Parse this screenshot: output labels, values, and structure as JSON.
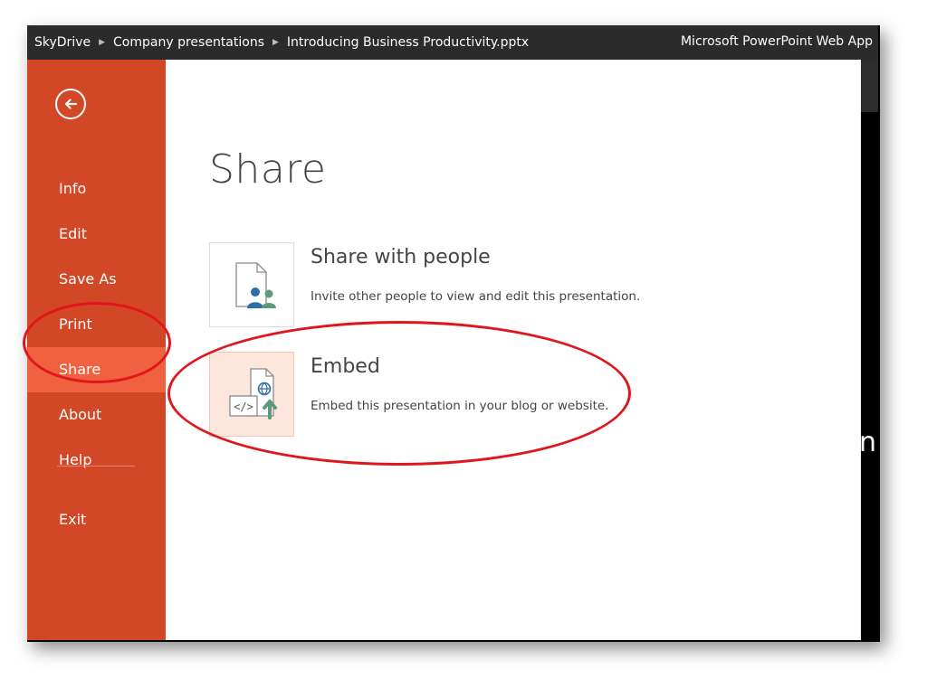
{
  "titlebar": {
    "breadcrumbs": [
      "SkyDrive",
      "Company presentations",
      "Introducing Business Productivity.pptx"
    ],
    "app_name": "Microsoft PowerPoint Web App"
  },
  "sidebar": {
    "items": [
      {
        "label": "Info"
      },
      {
        "label": "Edit"
      },
      {
        "label": "Save As"
      },
      {
        "label": "Print"
      },
      {
        "label": "Share"
      },
      {
        "label": "About"
      },
      {
        "label": "Help"
      },
      {
        "label": "Exit"
      }
    ],
    "active": "Share"
  },
  "main": {
    "title": "Share",
    "options": [
      {
        "title": "Share with people",
        "description": "Invite other people to view and edit this presentation.",
        "icon": "share-people-icon"
      },
      {
        "title": "Embed",
        "description": "Embed this presentation in your blog or website.",
        "icon": "embed-icon",
        "selected": true
      }
    ]
  },
  "background_peek": "n",
  "colors": {
    "accent": "#d24726",
    "accent_active": "#f0623f",
    "titlebar": "#2b2b2b",
    "annotation": "#e0161c"
  }
}
